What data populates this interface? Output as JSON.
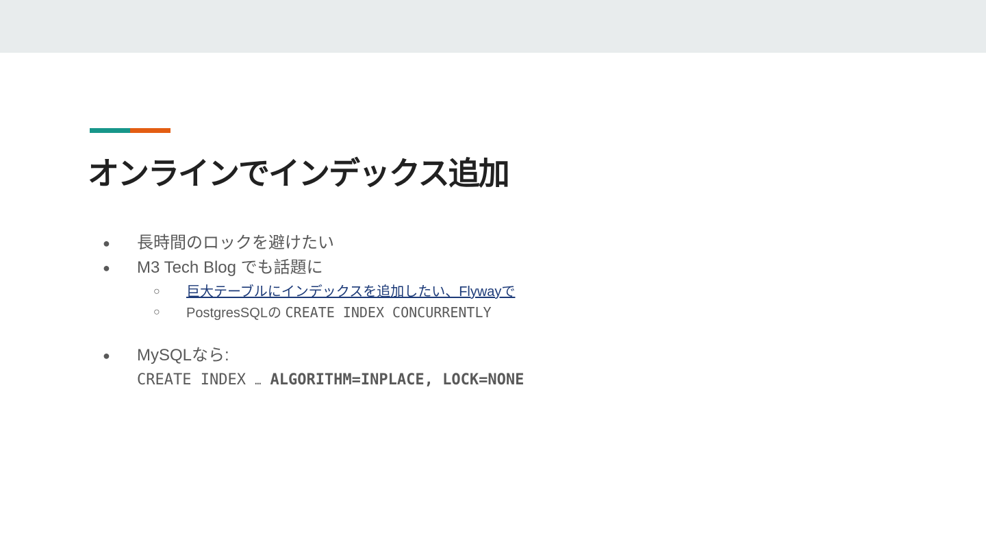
{
  "colors": {
    "topbar": "#e8eced",
    "accent_teal": "#17968a",
    "accent_orange": "#e35d12",
    "title": "#212121",
    "body_text": "#595959",
    "link": "#1c3a78"
  },
  "slide": {
    "title": "オンラインでインデックス追加",
    "bullets": [
      {
        "symbol": "●",
        "text": "長時間のロックを避けたい"
      },
      {
        "symbol": "●",
        "text": "M3 Tech Blog でも話題に",
        "children": [
          {
            "symbol": "○",
            "link_text": "巨大テーブルにインデックスを追加したい、Flywayで"
          },
          {
            "symbol": "○",
            "text": "PostgresSQLの ",
            "code": "CREATE INDEX CONCURRENTLY"
          }
        ]
      },
      {
        "symbol": "●",
        "text": "MySQLなら:",
        "code_line": {
          "prefix": "CREATE INDEX ",
          "ellipsis": "…",
          "bold": " ALGORITHM=INPLACE, LOCK=NONE"
        }
      }
    ]
  }
}
